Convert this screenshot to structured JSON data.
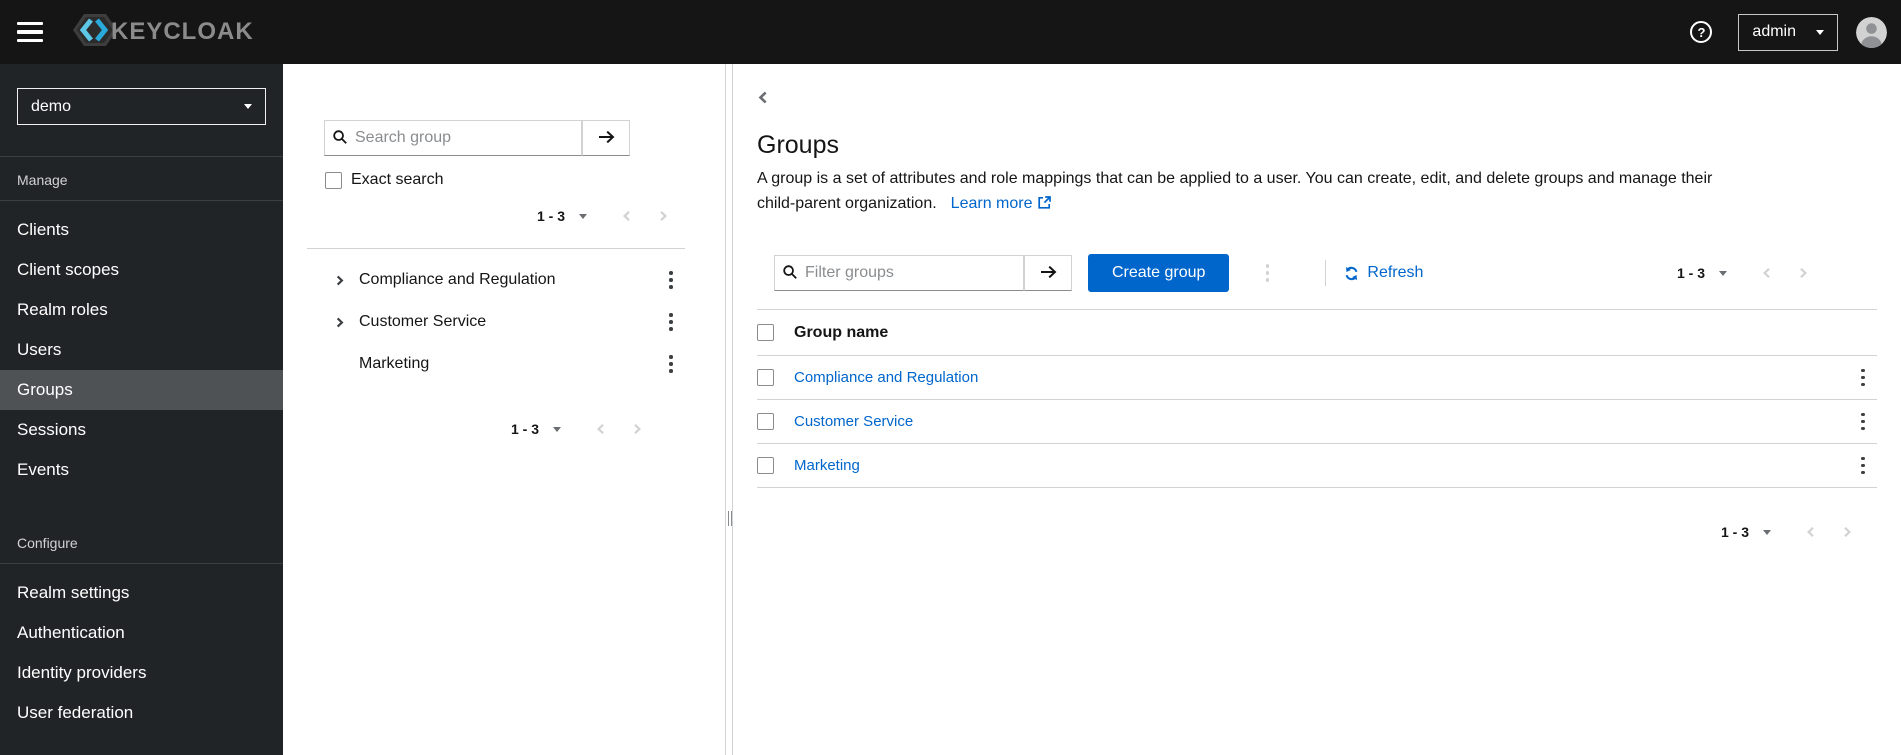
{
  "masthead": {
    "logo_text": "KEYCLOAK",
    "user_menu_label": "admin"
  },
  "sidebar": {
    "realm_selector": {
      "value": "demo"
    },
    "sections": [
      {
        "title": "Manage",
        "items": [
          {
            "label": "Clients"
          },
          {
            "label": "Client scopes"
          },
          {
            "label": "Realm roles"
          },
          {
            "label": "Users"
          },
          {
            "label": "Groups",
            "selected": true
          },
          {
            "label": "Sessions"
          },
          {
            "label": "Events"
          }
        ]
      },
      {
        "title": "Configure",
        "items": [
          {
            "label": "Realm settings"
          },
          {
            "label": "Authentication"
          },
          {
            "label": "Identity providers"
          },
          {
            "label": "User federation"
          }
        ]
      }
    ]
  },
  "tree_panel": {
    "search_placeholder": "Search group",
    "exact_search_label": "Exact search",
    "top_pagination": {
      "range": "1 - 3"
    },
    "items": [
      {
        "label": "Compliance and Regulation",
        "expandable": true
      },
      {
        "label": "Customer Service",
        "expandable": true
      },
      {
        "label": "Marketing",
        "expandable": false
      }
    ],
    "bottom_pagination": {
      "range": "1 - 3"
    }
  },
  "main": {
    "title": "Groups",
    "description_line1": "A group is a set of attributes and role mappings that can be applied to a user. You can create, edit, and delete groups and manage their",
    "description_line2": "child-parent organization.",
    "learn_more_label": "Learn more",
    "toolbar": {
      "filter_placeholder": "Filter groups",
      "create_button_label": "Create group",
      "refresh_label": "Refresh",
      "pagination": {
        "range": "1 - 3"
      }
    },
    "table": {
      "header": {
        "name_column": "Group name"
      },
      "rows": [
        {
          "name": "Compliance and Regulation"
        },
        {
          "name": "Customer Service"
        },
        {
          "name": "Marketing"
        }
      ]
    },
    "bottom_pagination": {
      "range": "1 - 3"
    }
  },
  "icons": [
    "hamburger-icon",
    "keycloak-logo-icon",
    "help-icon",
    "caret-down-icon",
    "avatar-icon",
    "search-icon",
    "arrow-right-icon",
    "angle-right-icon",
    "angle-left-icon",
    "kebab-icon",
    "sync-icon",
    "external-link-icon",
    "back-chevron-icon",
    "splitter-grip-icon"
  ],
  "colors": {
    "accent": "#0066cc",
    "link": "#0066cc",
    "masthead_bg": "#151515",
    "sidebar_bg": "#212427",
    "sidebar_selected_bg": "#4f5255",
    "logo_blue": "#3cb4e0",
    "border": "#d2d2d2"
  }
}
